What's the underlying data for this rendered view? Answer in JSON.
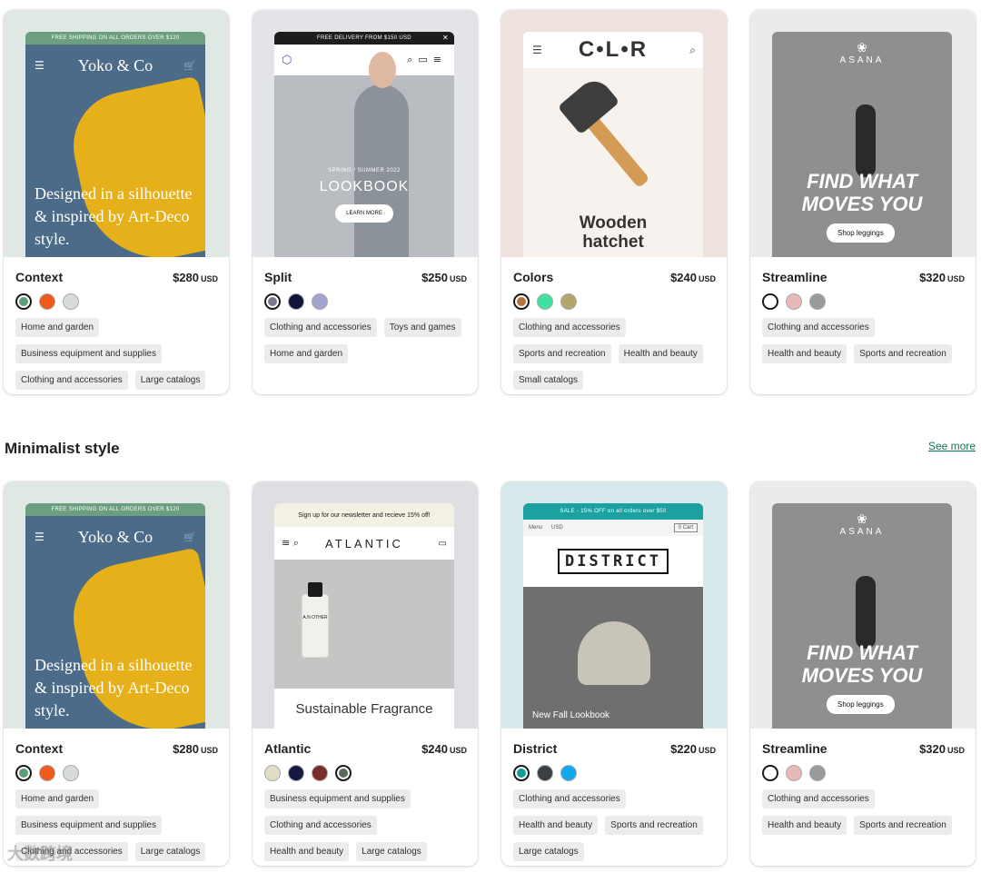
{
  "row1": [
    {
      "name": "Context",
      "price": "$280",
      "currency": "USD",
      "swatches": [
        "#5e9c7a",
        "#f05a1a",
        "#d8dcd8"
      ],
      "selected": 0,
      "tags": [
        "Home and garden",
        "Business equipment and supplies",
        "Clothing and accessories",
        "Large catalogs"
      ],
      "bg": "#dfe8e3"
    },
    {
      "name": "Split",
      "price": "$250",
      "currency": "USD",
      "swatches": [
        "#7a7a8e",
        "#13143a",
        "#a3a3cf"
      ],
      "selected": 0,
      "tags": [
        "Clothing and accessories",
        "Toys and games",
        "Home and garden"
      ],
      "bg": "#e2e4e8"
    },
    {
      "name": "Colors",
      "price": "$240",
      "currency": "USD",
      "swatches": [
        "#b4733f",
        "#3de2a2",
        "#b4a56c"
      ],
      "selected": 0,
      "tags": [
        "Clothing and accessories",
        "Sports and recreation",
        "Health and beauty",
        "Small catalogs"
      ],
      "bg": "#efe2de"
    },
    {
      "name": "Streamline",
      "price": "$320",
      "currency": "USD",
      "swatches": [
        "#ffffff",
        "#eab8b6",
        "#9a9a9a"
      ],
      "selected": 0,
      "tags": [
        "Clothing and accessories",
        "Health and beauty",
        "Sports and recreation"
      ],
      "bg": "#e9ebed"
    }
  ],
  "section": {
    "title": "Minimalist style",
    "see_more": "See more"
  },
  "row2": [
    {
      "name": "Context",
      "price": "$280",
      "currency": "USD",
      "swatches": [
        "#5e9c7a",
        "#f05a1a",
        "#d8dcd8"
      ],
      "selected": 0,
      "tags": [
        "Home and garden",
        "Business equipment and supplies",
        "Clothing and accessories",
        "Large catalogs"
      ],
      "bg": "#dfe8e3"
    },
    {
      "name": "Atlantic",
      "price": "$240",
      "currency": "USD",
      "swatches": [
        "#e0dcc6",
        "#151a40",
        "#7a2e2a",
        "#5a6a58"
      ],
      "selected": 3,
      "tags": [
        "Business equipment and supplies",
        "Clothing and accessories",
        "Health and beauty",
        "Large catalogs"
      ],
      "bg": "#dddfe2"
    },
    {
      "name": "District",
      "price": "$220",
      "currency": "USD",
      "swatches": [
        "#0f9c98",
        "#3a3f44",
        "#12a8ec"
      ],
      "selected": 0,
      "tags": [
        "Clothing and accessories",
        "Health and beauty",
        "Sports and recreation",
        "Large catalogs"
      ],
      "bg": "#d7e9ea"
    },
    {
      "name": "Streamline",
      "price": "$320",
      "currency": "USD",
      "swatches": [
        "#ffffff",
        "#eab8b6",
        "#9a9a9a"
      ],
      "selected": 0,
      "tags": [
        "Clothing and accessories",
        "Health and beauty",
        "Sports and recreation"
      ],
      "bg": "#e9ebed"
    }
  ],
  "previews": {
    "context": {
      "banner": "FREE SHIPPING ON ALL ORDERS OVER $120",
      "brand": "Yoko & Co",
      "headline": "Designed in a silhouette & inspired by Art-Deco style."
    },
    "split": {
      "banner": "FREE DELIVERY FROM $150 USD",
      "season": "SPRING / SUMMER 2022",
      "title": "LOOKBOOK",
      "cta": "LEARN MORE"
    },
    "colors": {
      "brand": "C•L•R",
      "title": "Wooden hatchet"
    },
    "streamline": {
      "brand": "ASANA",
      "headline": "FIND WHAT MOVES YOU",
      "cta": "Shop leggings"
    },
    "atlantic": {
      "banner": "Sign up for our newsletter and recieve 15% off!",
      "brand": "ATLANTIC",
      "title": "Sustainable Fragrance",
      "bottle": "A.N OTHER"
    },
    "district": {
      "banner": "SALE - 15% OFF on all orders over $50",
      "menu": "Menu",
      "currency": "USD",
      "cart": "0 Cart",
      "brand": "DISTRICT",
      "caption": "New Fall Lookbook"
    }
  },
  "watermark": "大数跨境"
}
